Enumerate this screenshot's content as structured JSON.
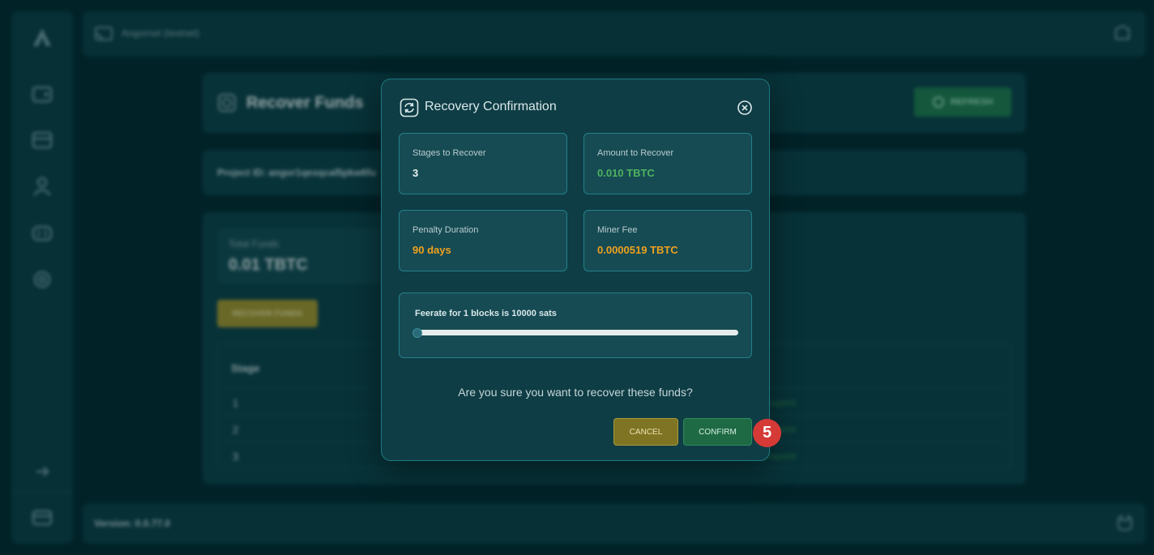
{
  "app": {
    "network_label": "Angornet (testnet)",
    "version_label": "Version: 0.0.77.0",
    "page_title": "Recover Funds",
    "refresh_label": "REFRESH",
    "project_id_label": "Project ID: angor1qexqcal5pkw6fu",
    "total_funds_label": "Total Funds",
    "total_funds_value": "0.01 TBTC",
    "recover_funds_button": "RECOVER FUNDS",
    "table": {
      "header": "Stage",
      "rows": [
        {
          "stage": "1",
          "status": "Unspent"
        },
        {
          "stage": "2",
          "status": "Unspent"
        },
        {
          "stage": "3",
          "status": "Unspent"
        }
      ]
    },
    "colors": {
      "page_bg": "#032a31",
      "panel_bg": "#0a3d45"
    }
  },
  "modal": {
    "title": "Recovery Confirmation",
    "header_icon": "recycle-icon",
    "close_icon": "close-circle-icon",
    "cards": {
      "stages": {
        "label": "Stages to Recover",
        "value": "3",
        "color": "#e8f1f2"
      },
      "amount": {
        "label": "Amount to Recover",
        "value": "0.010 TBTC",
        "color": "#4fb35f"
      },
      "penalty": {
        "label": "Penalty Duration",
        "value": "90 days",
        "color": "#f0a11e"
      },
      "miner_fee": {
        "label": "Miner Fee",
        "value": "0.0000519 TBTC",
        "color": "#f0a11e"
      }
    },
    "feerate": {
      "label": "Feerate for 1 blocks is 10000 sats",
      "slider_value": 0.0
    },
    "question": "Are you sure you want to recover these funds?",
    "cancel_label": "CANCEL",
    "confirm_label": "CONFIRM"
  },
  "step_badge": "5"
}
